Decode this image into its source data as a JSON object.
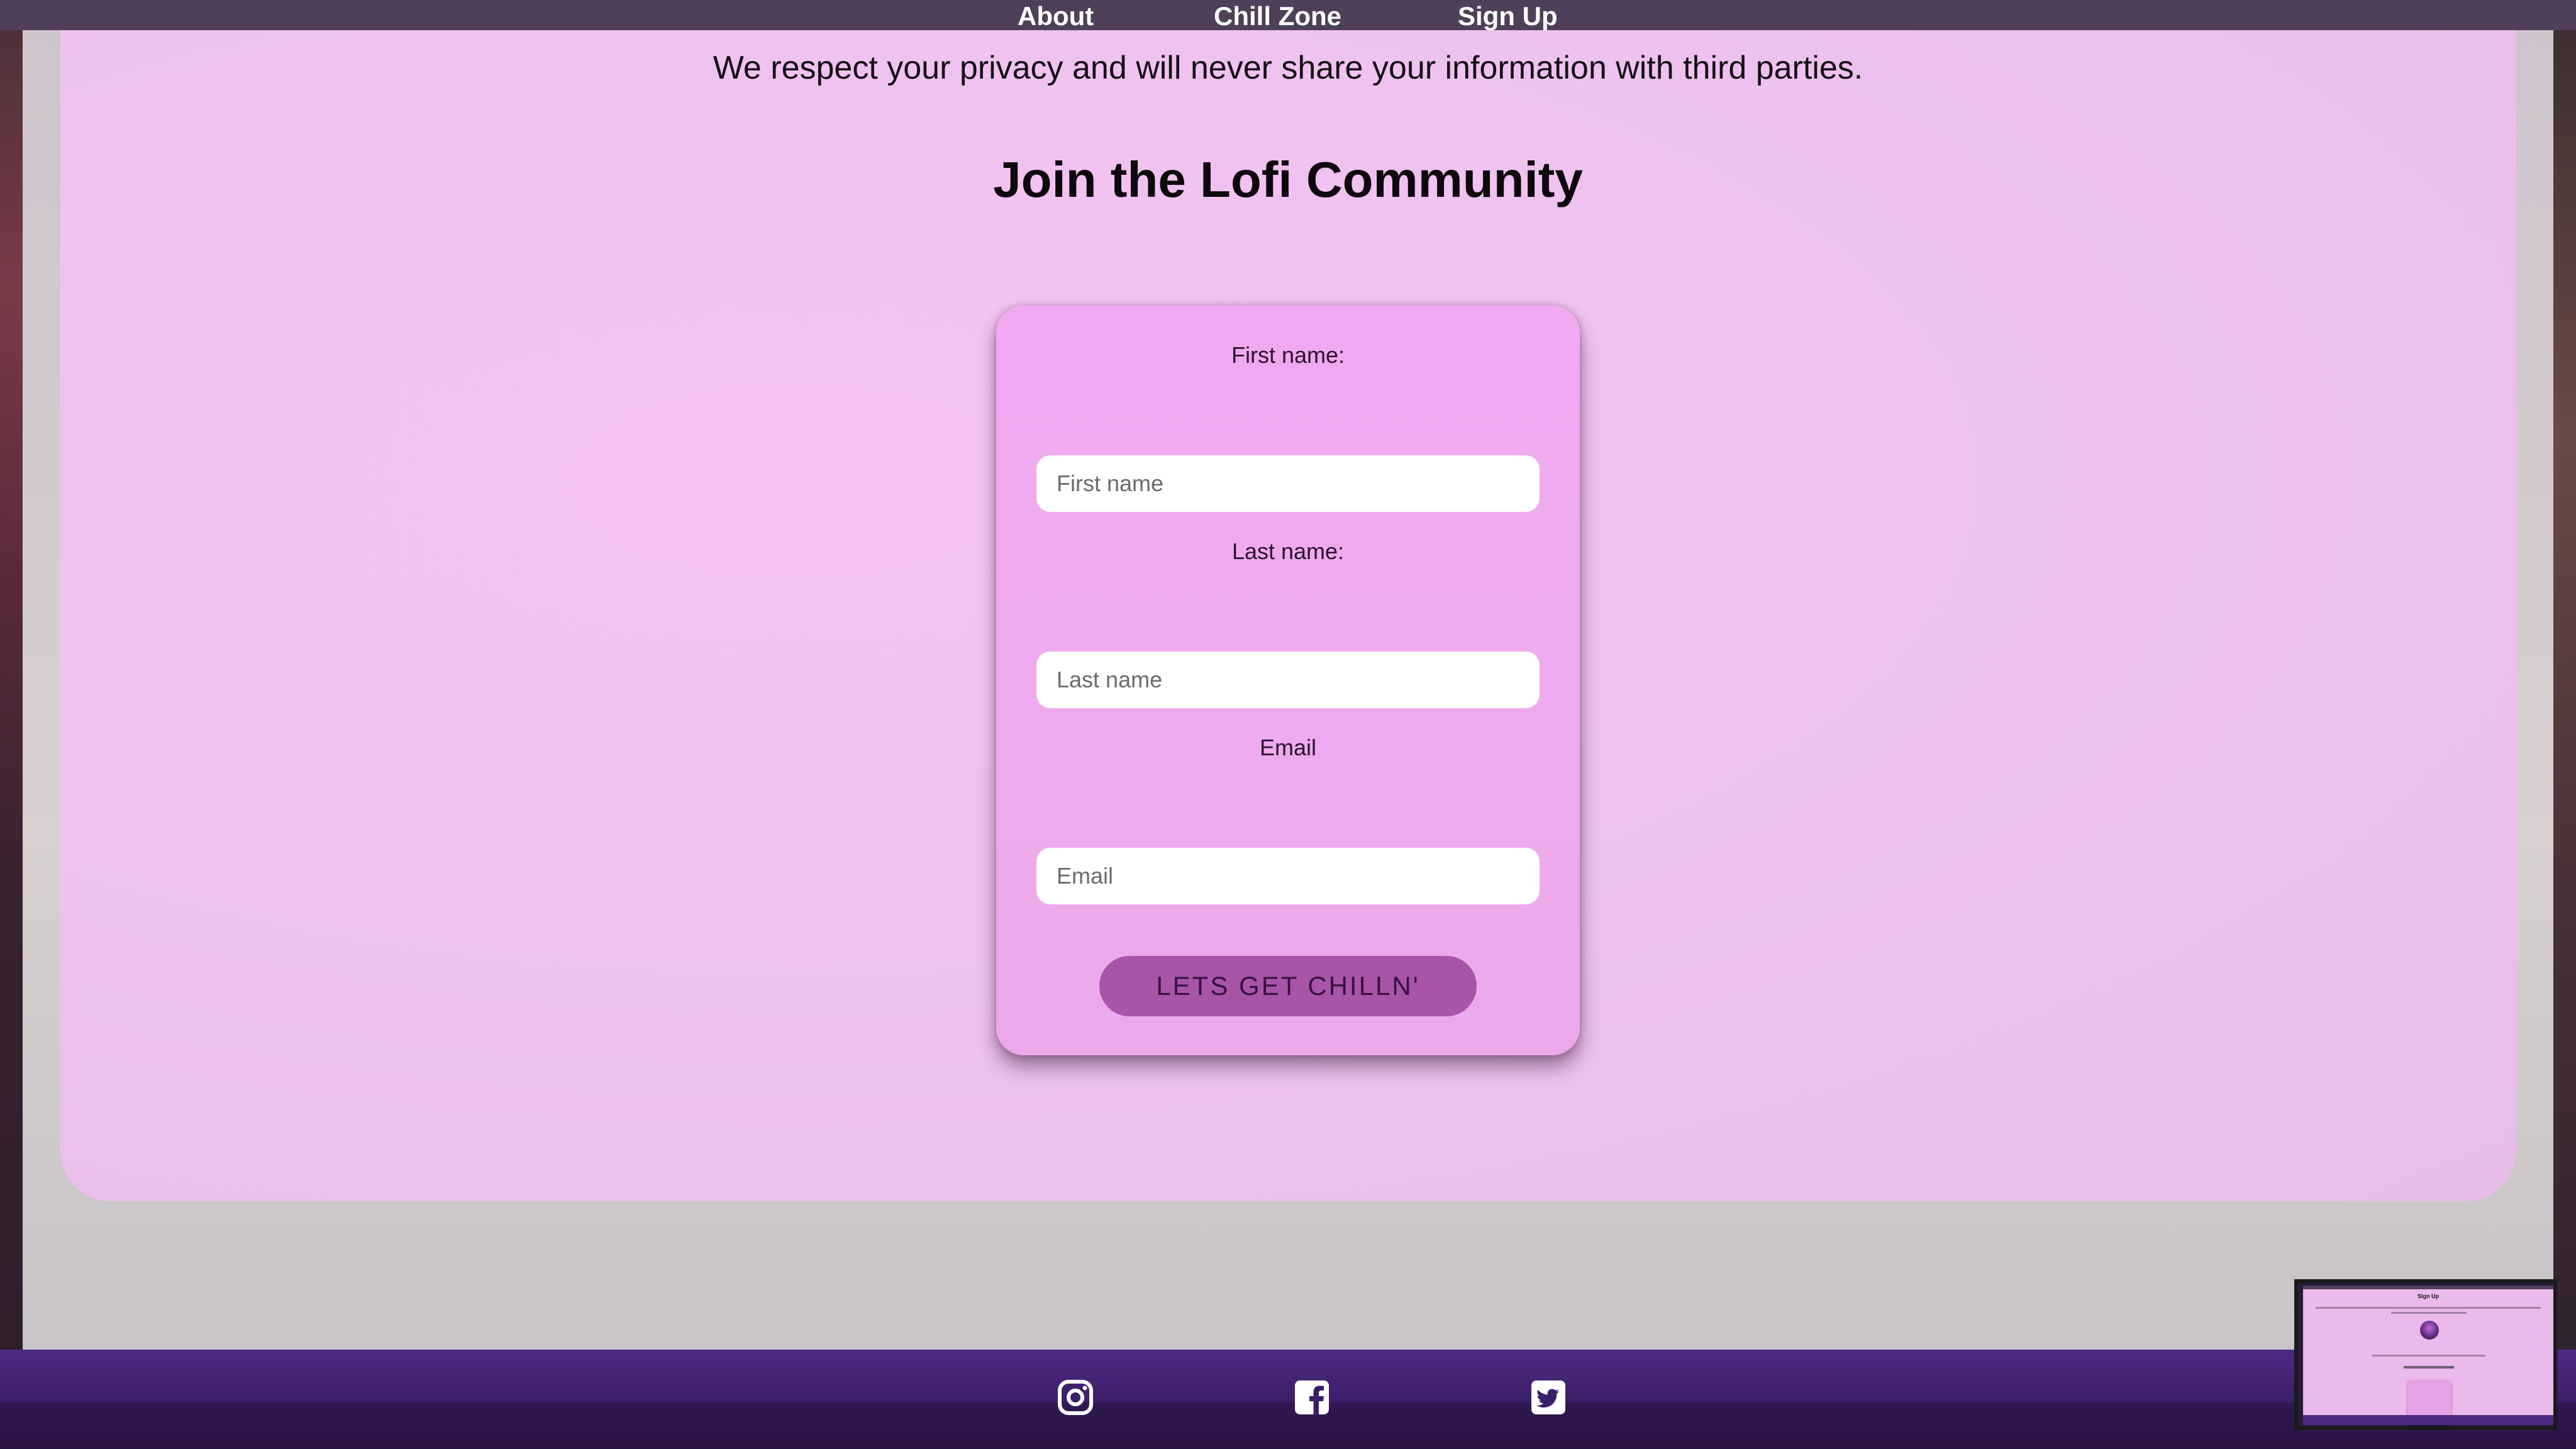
{
  "nav": {
    "about": "About",
    "chill_zone": "Chill Zone",
    "sign_up": "Sign Up"
  },
  "privacy_notice": "We respect your privacy and will never share your information with third parties.",
  "join_title": "Join the Lofi Community",
  "form": {
    "first_name_label": "First name:",
    "first_name_placeholder": "First name",
    "last_name_label": "Last name:",
    "last_name_placeholder": "Last name",
    "email_label": "Email",
    "email_placeholder": "Email",
    "submit_label": "LETS GET CHILLN'"
  },
  "footer": {
    "icons": [
      "instagram-icon",
      "facebook-icon",
      "twitter-icon"
    ]
  },
  "thumbnail": {
    "title": "Sign Up"
  },
  "colors": {
    "nav_bg": "#4f3f58",
    "panel_pink": "#f7c3f3",
    "card_pink": "#f1a9f1",
    "button_purple": "#a855a8",
    "footer_purple": "#4e2a82"
  }
}
